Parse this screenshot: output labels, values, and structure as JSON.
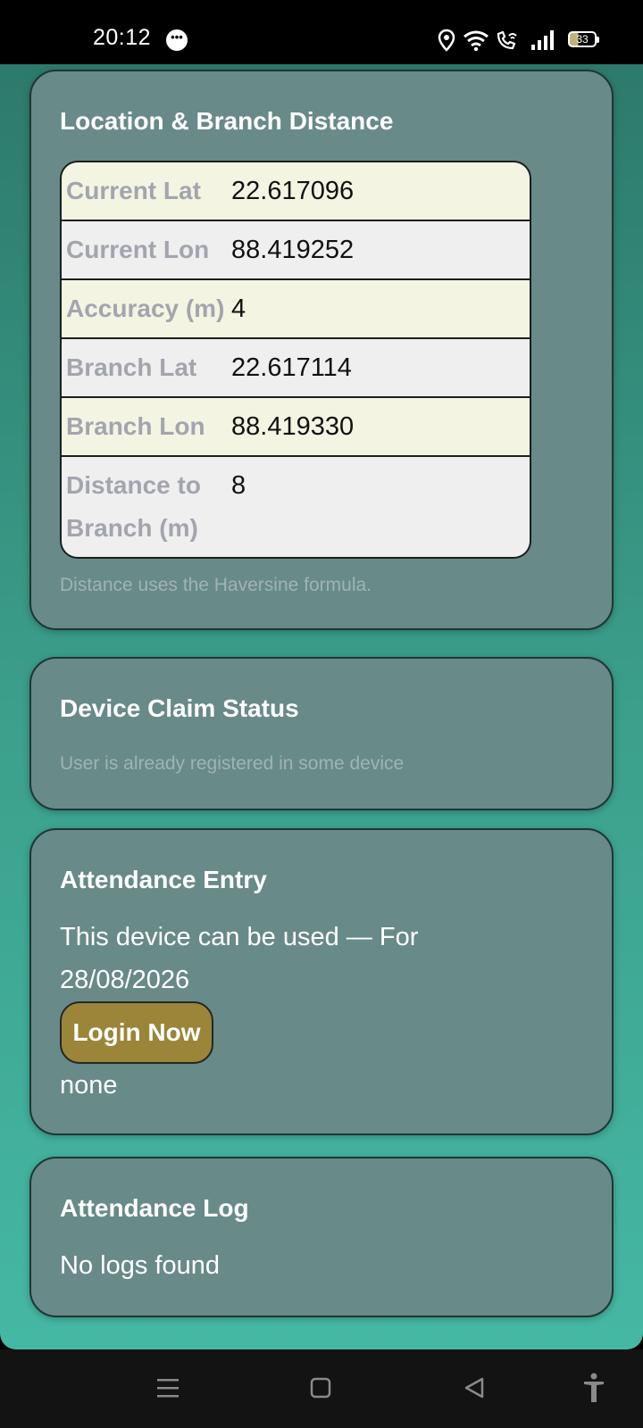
{
  "status_bar": {
    "time": "20:12",
    "battery": "33",
    "icons": [
      "message-icon",
      "location-icon",
      "wifi-icon",
      "wifi-call-icon",
      "signal-icon",
      "battery-icon"
    ]
  },
  "location_card": {
    "title": "Location & Branch Distance",
    "rows": [
      {
        "label": "Current Lat",
        "value": "22.617096"
      },
      {
        "label": "Current Lon",
        "value": "88.419252"
      },
      {
        "label": "Accuracy (m)",
        "value": "4"
      },
      {
        "label": "Branch Lat",
        "value": "22.617114"
      },
      {
        "label": "Branch Lon",
        "value": "88.419330"
      },
      {
        "label": "Distance to Branch (m)",
        "value": "8"
      }
    ],
    "note": "Distance uses the Haversine formula."
  },
  "device_card": {
    "title": "Device Claim Status",
    "status": "User is already registered in some device"
  },
  "attendance_entry": {
    "title": "Attendance Entry",
    "message": "This device can be used — For 28/08/2026",
    "login_label": "Login Now",
    "result": "none"
  },
  "attendance_log": {
    "title": "Attendance Log",
    "empty_text": "No logs found"
  },
  "nav_bar": {
    "icons": [
      "menu-icon",
      "home-icon",
      "back-icon",
      "accessibility-icon"
    ]
  },
  "colors": {
    "card_bg": "#688a88",
    "button_bg": "#9a8538",
    "background_top": "#2d7a6b",
    "background_bottom": "#45b8a4"
  }
}
